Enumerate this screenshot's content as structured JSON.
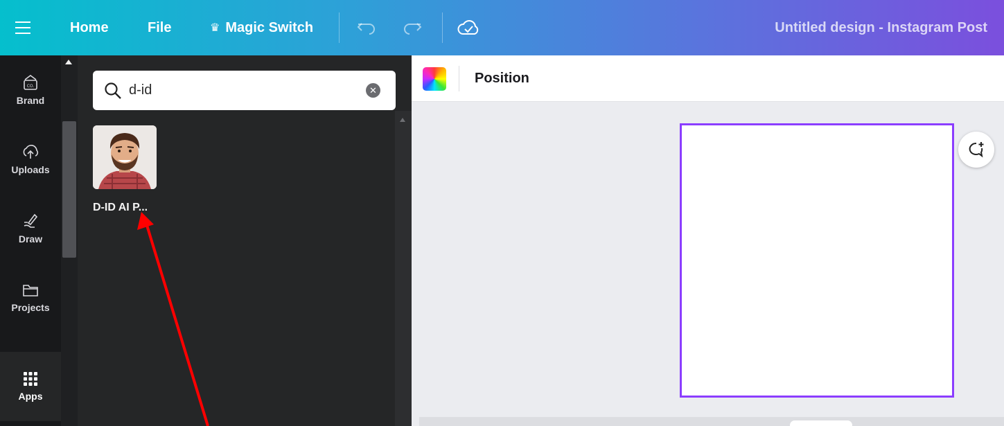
{
  "topbar": {
    "home": "Home",
    "file": "File",
    "magic_switch": "Magic Switch",
    "design_title": "Untitled design - Instagram Post",
    "icons": [
      "menu-icon",
      "crown-icon",
      "undo-icon",
      "redo-icon",
      "cloud-check-icon"
    ]
  },
  "rail": {
    "items": [
      {
        "label": "Brand",
        "icon": "brand-icon"
      },
      {
        "label": "Uploads",
        "icon": "upload-cloud-icon"
      },
      {
        "label": "Draw",
        "icon": "pen-icon"
      },
      {
        "label": "Projects",
        "icon": "folder-icon"
      },
      {
        "label": "Apps",
        "icon": "apps-grid-icon",
        "active": true
      }
    ]
  },
  "panel": {
    "search": {
      "value": "d-id",
      "icon": "search-icon",
      "clear_icon": "clear-icon"
    },
    "results": [
      {
        "name": "D-ID AI P...",
        "thumb": "app-avatar-face"
      }
    ]
  },
  "editor": {
    "toolbar": {
      "position_label": "Position"
    },
    "accent_color": "#8b3dff"
  },
  "annotation": {
    "color": "#ff0000",
    "type": "arrow"
  }
}
